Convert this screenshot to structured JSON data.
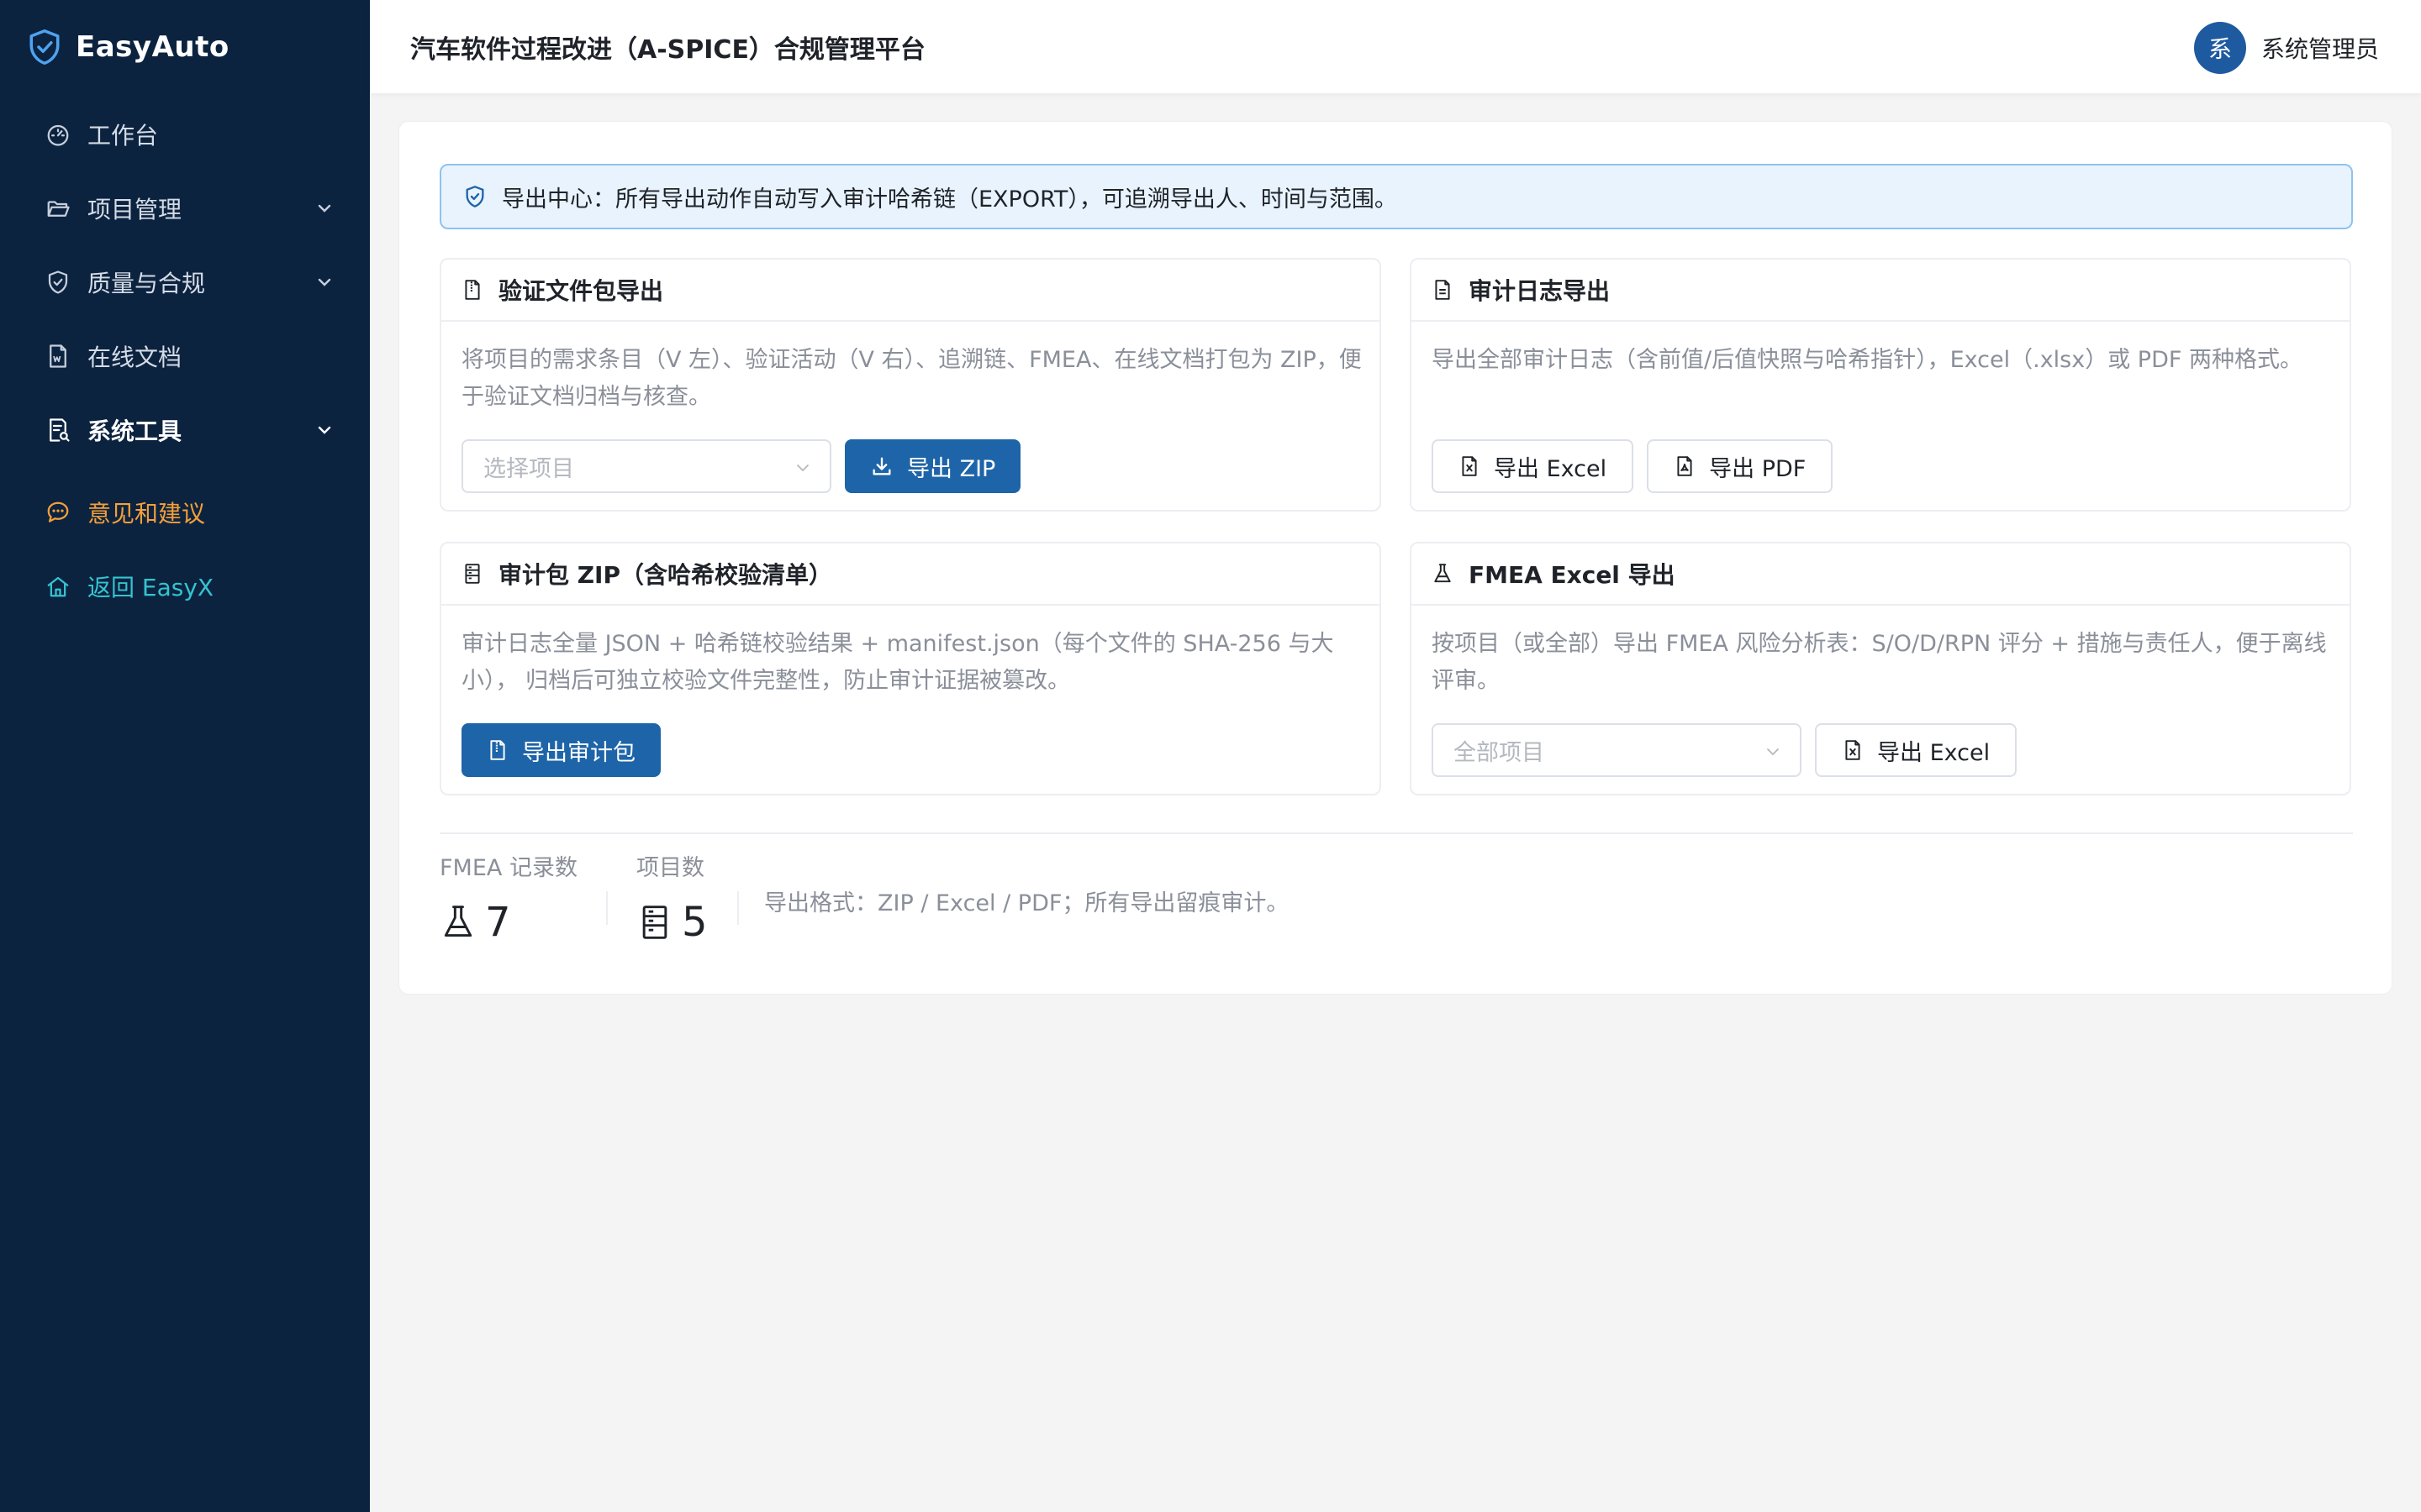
{
  "app": {
    "name": "EasyAuto",
    "title": "汽车软件过程改进（A-SPICE）合规管理平台"
  },
  "user": {
    "avatar_char": "系",
    "name": "系统管理员"
  },
  "sidebar": {
    "items": [
      {
        "label": "工作台"
      },
      {
        "label": "项目管理"
      },
      {
        "label": "质量与合规"
      },
      {
        "label": "在线文档"
      },
      {
        "label": "系统工具"
      },
      {
        "label": "意见和建议"
      },
      {
        "label": "返回 EasyX"
      }
    ]
  },
  "alert": {
    "text": "导出中心：所有导出动作自动写入审计哈希链（EXPORT），可追溯导出人、时间与范围。"
  },
  "panels": {
    "verification": {
      "title": "验证文件包导出",
      "desc": "将项目的需求条目（V 左）、验证活动（V 右）、追溯链、FMEA、在线文档打包为 ZIP，便于验证文档归档与核查。",
      "select_placeholder": "选择项目",
      "button": "导出 ZIP"
    },
    "audit_log": {
      "title": "审计日志导出",
      "desc": "导出全部审计日志（含前值/后值快照与哈希指针），Excel（.xlsx）或 PDF 两种格式。",
      "button_excel": "导出 Excel",
      "button_pdf": "导出 PDF"
    },
    "audit_package": {
      "title": "审计包 ZIP（含哈希校验清单）",
      "desc": "审计日志全量 JSON + 哈希链校验结果 + manifest.json（每个文件的 SHA-256 与大小）， 归档后可独立校验文件完整性，防止审计证据被篡改。",
      "button": "导出审计包"
    },
    "fmea": {
      "title": "FMEA Excel 导出",
      "desc": "按项目（或全部）导出 FMEA 风险分析表：S/O/D/RPN 评分 + 措施与责任人，便于离线评审。",
      "select_placeholder": "全部项目",
      "button": "导出 Excel"
    }
  },
  "stats": {
    "fmea": {
      "label": "FMEA 记录数",
      "value": "7"
    },
    "projects": {
      "label": "项目数",
      "value": "5"
    },
    "note": "导出格式：ZIP / Excel / PDF；所有导出留痕审计。"
  },
  "colors": {
    "sidebar_bg": "#0c2340",
    "primary": "#1e64a8",
    "accent_orange": "#f3a03b",
    "accent_teal": "#35c3cf",
    "alert_bg": "#e8f3fd"
  }
}
